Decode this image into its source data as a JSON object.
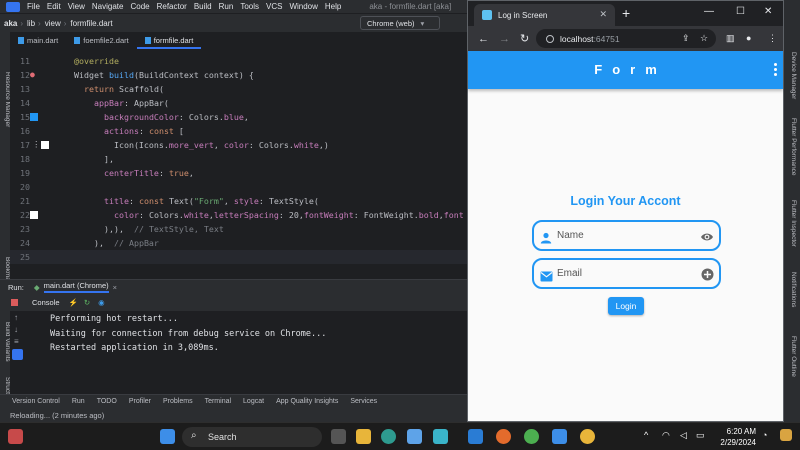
{
  "ide": {
    "menu": [
      "File",
      "Edit",
      "View",
      "Navigate",
      "Code",
      "Refactor",
      "Build",
      "Run",
      "Tools",
      "VCS",
      "Window",
      "Help"
    ],
    "window_title": "aka - formfile.dart [aka]",
    "breadcrumb": [
      "aka",
      "lib",
      "view",
      "formfile.dart"
    ],
    "device_selector": "Chrome (web)",
    "tabs": [
      "main.dart",
      "foemfile2.dart",
      "formfile.dart"
    ],
    "line_numbers": [
      "11",
      "12",
      "13",
      "14",
      "15",
      "16",
      "17",
      "18",
      "19",
      "20",
      "21",
      "22",
      "23",
      "24",
      "25"
    ],
    "run_label": "Run:",
    "run_config": "main.dart (Chrome)",
    "console_tab": "Console",
    "console_lines": [
      "Performing hot restart...",
      "Waiting for connection from debug service on Chrome...",
      "Restarted application in 3,089ms."
    ],
    "tool_windows": [
      "Version Control",
      "Run",
      "TODO",
      "Profiler",
      "Problems",
      "Terminal",
      "Logcat",
      "App Quality Insights",
      "Services"
    ],
    "status": "Reloading... (2 minutes ago)",
    "right_tools": [
      "Device Manager",
      "Flutter Performance",
      "Flutter Inspector",
      "Notifications",
      "Flutter Outline"
    ],
    "left_tools": [
      "Resource Manager",
      "Bookmarks",
      "Build Variants",
      "Structure"
    ]
  },
  "chrome": {
    "tab_title": "Log in Screen",
    "url_host": "localhost",
    "url_port": ":64751"
  },
  "app": {
    "appbar_title": "Form",
    "heading": "Login Your Accont",
    "name_placeholder": "Name",
    "email_placeholder": "Email",
    "login_button": "Login",
    "colors": {
      "primary": "#2196f3",
      "white": "#ffffff"
    }
  },
  "taskbar": {
    "search": "Search",
    "time": "6:20 AM",
    "date": "2/29/2024"
  }
}
